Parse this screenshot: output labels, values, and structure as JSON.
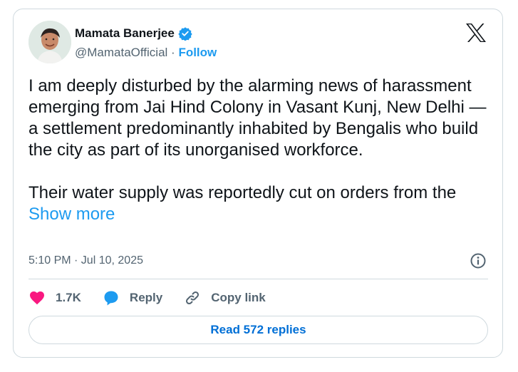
{
  "author": {
    "display_name": "Mamata Banerjee",
    "handle": "@MamataOfficial",
    "separator": " · ",
    "follow_label": "Follow",
    "verified_icon": "verified-badge-icon"
  },
  "tweet": {
    "paragraph1": "I am deeply disturbed by the alarming news of harassment emerging from Jai Hind Colony in Vasant Kunj, New Delhi — a settlement predominantly inhabited by Bengalis who build the city as part of its unorganised workforce.",
    "paragraph2_start": "Their water supply was reportedly cut on orders from the ",
    "show_more_label": "Show more",
    "timestamp": "5:10 PM · Jul 10, 2025"
  },
  "actions": {
    "like_count": "1.7K",
    "reply_label": "Reply",
    "copy_link_label": "Copy link"
  },
  "read_replies_label": "Read 572 replies",
  "colors": {
    "accent": "#1d9bf0",
    "like": "#f91880",
    "text": "#0f1419",
    "muted": "#536471",
    "border": "#cfd9de"
  }
}
